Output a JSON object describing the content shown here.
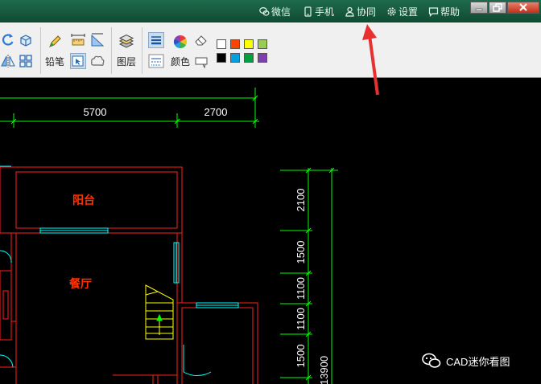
{
  "titlebar": {
    "links": [
      {
        "id": "wechat",
        "label": "微信",
        "icon": "wechat-icon"
      },
      {
        "id": "phone",
        "label": "手机",
        "icon": "phone-icon"
      },
      {
        "id": "collab",
        "label": "协同",
        "icon": "users-icon"
      },
      {
        "id": "settings",
        "label": "设置",
        "icon": "gear-icon"
      },
      {
        "id": "help",
        "label": "帮助",
        "icon": "chat-icon"
      }
    ],
    "window_controls": [
      "minimize",
      "restore",
      "close"
    ]
  },
  "toolbar": {
    "pencil_label": "铅笔",
    "layer_label": "图层",
    "color_label": "颜色",
    "swatches_row1": [
      "#ffffff",
      "#ff4400",
      "#ffff00",
      "#99cc55"
    ],
    "swatches_row2": [
      "#000000",
      "#00a0e0",
      "#00a040",
      "#8040b0"
    ]
  },
  "drawing": {
    "dimensions_top": [
      "5700",
      "2700"
    ],
    "dimensions_right": [
      "2100",
      "1500",
      "1100",
      "1100",
      "1500",
      "13900"
    ],
    "rooms": [
      "阳台",
      "餐厅"
    ],
    "colors": {
      "dim": "#00ff00",
      "wall": "#ff2020",
      "window": "#00ffff",
      "stair": "#ffff00",
      "text": "#ff3300"
    }
  },
  "watermark": {
    "text": "CAD迷你看图",
    "icon": "wechat-icon"
  },
  "annotation": {
    "color": "#e83030"
  }
}
